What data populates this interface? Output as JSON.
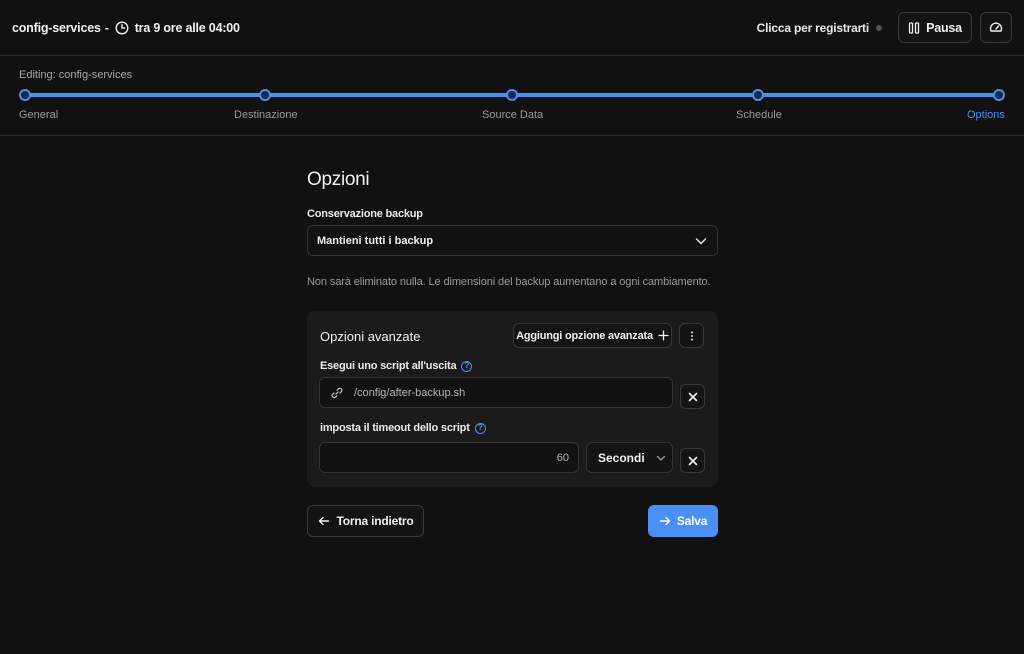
{
  "header": {
    "job_name": "config-services",
    "separator": "-",
    "next_run": "tra 9 ore alle 04:00",
    "register_link": "Clicca per registrarti",
    "pause_label": "Pausa"
  },
  "stepper": {
    "editing_label": "Editing: config-services",
    "steps": [
      {
        "label": "General"
      },
      {
        "label": "Destinazione"
      },
      {
        "label": "Source Data"
      },
      {
        "label": "Schedule"
      },
      {
        "label": "Options"
      }
    ],
    "active_step": "Options",
    "accent_color": "#4a8ff5"
  },
  "form": {
    "title": "Opzioni",
    "retention_label": "Conservazione backup",
    "retention_value": "Mantieni tutti i backup",
    "retention_helper": "Non sarà eliminato nulla. Le dimensioni del backup aumentano a ogni cambiamento."
  },
  "advanced": {
    "title": "Opzioni avanzate",
    "add_button": "Aggiungi opzione avanzata",
    "script_label": "Esegui uno script all'uscita",
    "script_value": "/config/after-backup.sh",
    "timeout_label": "imposta il timeout dello script",
    "timeout_value": "60",
    "timeout_unit": "Secondi"
  },
  "actions": {
    "back_label": "Torna indietro",
    "save_label": "Salva"
  },
  "icons": {
    "clock": "clock-icon",
    "pause": "pause-icon",
    "dashboard": "gauge-icon",
    "chevron": "chevron-down-icon",
    "link": "link-icon",
    "plus": "plus-icon",
    "more": "vertical-dots-icon",
    "close": "close-icon",
    "back": "arrow-left-icon",
    "save": "arrow-right-icon"
  }
}
